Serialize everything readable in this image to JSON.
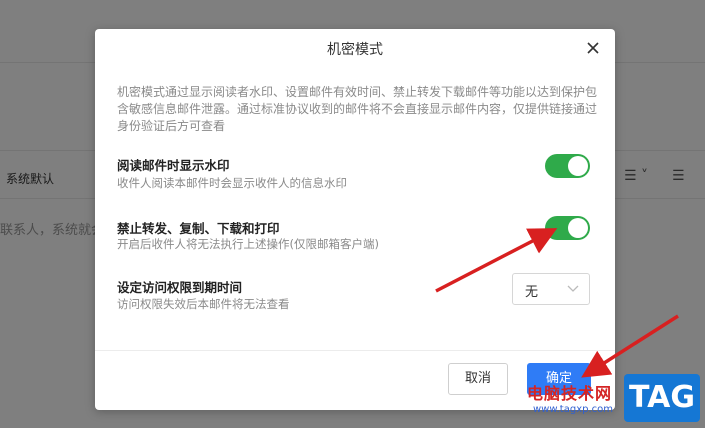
{
  "background": {
    "row_label": "系统默认",
    "row_hint": "联系人，系统就会",
    "list_icon": "list-format-icon",
    "indent_icon": "indent-icon"
  },
  "dialog": {
    "title": "机密模式",
    "description": "机密模式通过显示阅读者水印、设置邮件有效时间、禁止转发下载邮件等功能以达到保护包含敏感信息邮件泄露。通过标准协议收到的邮件将不会直接显示邮件内容，仅提供链接通过身份验证后方可查看",
    "options": [
      {
        "title": "阅读邮件时显示水印",
        "subtitle": "收件人阅读本邮件时会显示收件人的信息水印",
        "enabled": true
      },
      {
        "title": "禁止转发、复制、下载和打印",
        "subtitle": "开启后收件人将无法执行上述操作(仅限邮箱客户端)",
        "enabled": true
      }
    ],
    "expiry": {
      "title": "设定访问权限到期时间",
      "subtitle": "访问权限失效后本邮件将无法查看",
      "selected": "无"
    },
    "cancel_label": "取消",
    "ok_label": "确定",
    "toggle_color": "#2faa4a",
    "primary_color": "#2f7cf6"
  },
  "watermark": {
    "site_name": "电脑技术网",
    "url": "www.tagxp.com",
    "tag": "TAG"
  }
}
